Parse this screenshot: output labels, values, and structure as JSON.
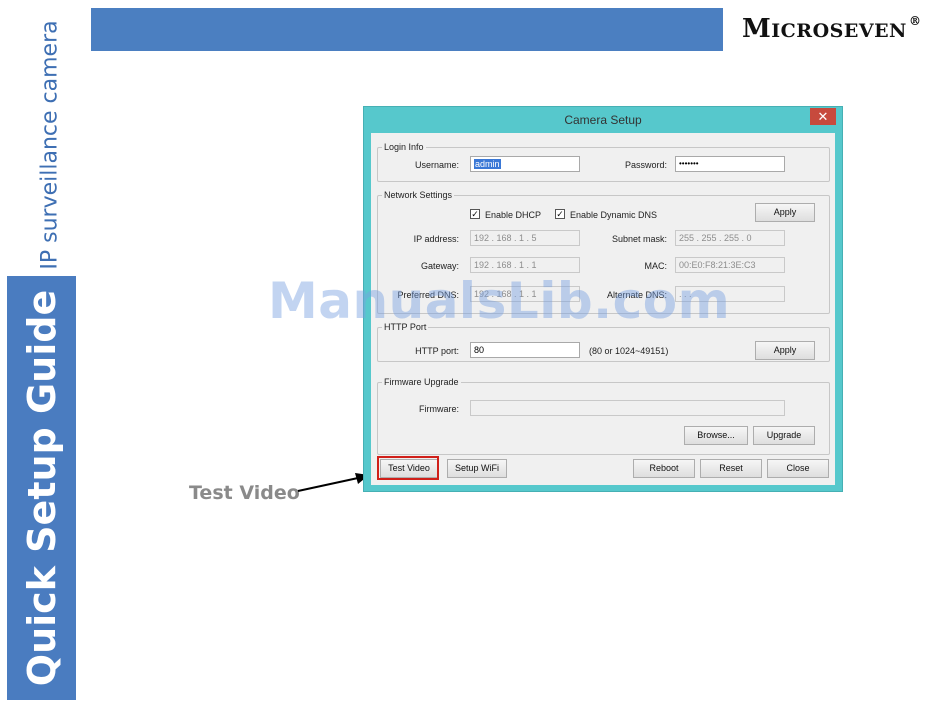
{
  "sidebar": {
    "subtitle": "IP surveillance camera",
    "guide_title": "Quick Setup Guide"
  },
  "brand": {
    "logo_initial": "M",
    "logo_rest": "ICROSEVEN",
    "logo_reg": "®"
  },
  "watermark": "ManualsLib.com",
  "callout": {
    "label": "Test Video"
  },
  "dialog": {
    "title": "Camera Setup",
    "close_glyph": "✕",
    "login": {
      "legend": "Login Info",
      "username_label": "Username:",
      "username_value": "admin",
      "password_label": "Password:",
      "password_value": "•••••••"
    },
    "network": {
      "legend": "Network Settings",
      "dhcp_label": "Enable DHCP",
      "dhcp_checked": "✓",
      "ddns_label": "Enable Dynamic DNS",
      "ddns_checked": "✓",
      "apply_label": "Apply",
      "ip_label": "IP address:",
      "ip_value": "192  .  168  .    1   .    5",
      "subnet_label": "Subnet mask:",
      "subnet_value": "255  .  255  .  255  .    0",
      "gateway_label": "Gateway:",
      "gateway_value": "192  .  168  .    1   .    1",
      "mac_label": "MAC:",
      "mac_value": "00:E0:F8:21:3E:C3",
      "dns_label": "Preferred DNS:",
      "dns_value": "192  .  168  .    1   .    1",
      "alt_dns_label": "Alternate DNS:",
      "alt_dns_value": "          .          .          ."
    },
    "http": {
      "legend": "HTTP Port",
      "port_label": "HTTP port:",
      "port_value": "80",
      "range_hint": "(80 or 1024~49151)",
      "apply_label": "Apply"
    },
    "firmware": {
      "legend": "Firmware Upgrade",
      "firmware_label": "Firmware:",
      "firmware_value": "",
      "browse_label": "Browse...",
      "upgrade_label": "Upgrade"
    },
    "buttons": {
      "test_video": "Test Video",
      "setup_wifi": "Setup WiFi",
      "reboot": "Reboot",
      "reset": "Reset",
      "close": "Close"
    }
  }
}
